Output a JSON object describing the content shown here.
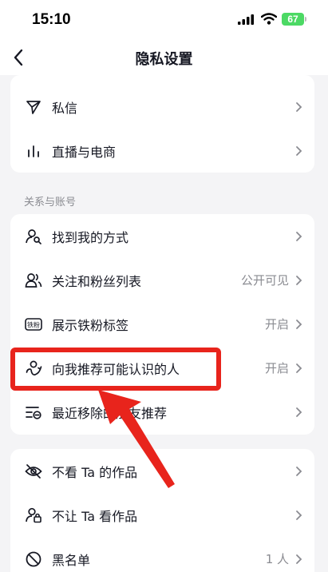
{
  "status_bar": {
    "time": "15:10",
    "battery": "67"
  },
  "header": {
    "title": "隐私设置"
  },
  "top_card": {
    "items": [
      {
        "label": "私信",
        "icon": "send-icon"
      },
      {
        "label": "直播与电商",
        "icon": "bar-chart-icon"
      }
    ]
  },
  "relations_section": {
    "title": "关系与账号",
    "items": [
      {
        "label": "找到我的方式",
        "value": "",
        "icon": "user-search-icon"
      },
      {
        "label": "关注和粉丝列表",
        "value": "公开可见",
        "icon": "users-icon"
      },
      {
        "label": "展示铁粉标签",
        "value": "开启",
        "icon": "iron-fan-badge-icon",
        "badge": "铁粉"
      },
      {
        "label": "向我推荐可能认识的人",
        "value": "开启",
        "icon": "recommend-user-icon"
      },
      {
        "label": "最近移除的朋友推荐",
        "value": "",
        "icon": "removed-list-icon"
      }
    ]
  },
  "block_card": {
    "items": [
      {
        "label": "不看 Ta 的作品",
        "value": "",
        "icon": "eye-off-icon"
      },
      {
        "label": "不让 Ta 看作品",
        "value": "",
        "icon": "user-lock-icon"
      },
      {
        "label": "黑名单",
        "value": "1 人",
        "icon": "block-icon"
      }
    ]
  },
  "colors": {
    "highlight": "#e8241c",
    "background": "#f4f4f6",
    "battery": "#4cd964"
  }
}
